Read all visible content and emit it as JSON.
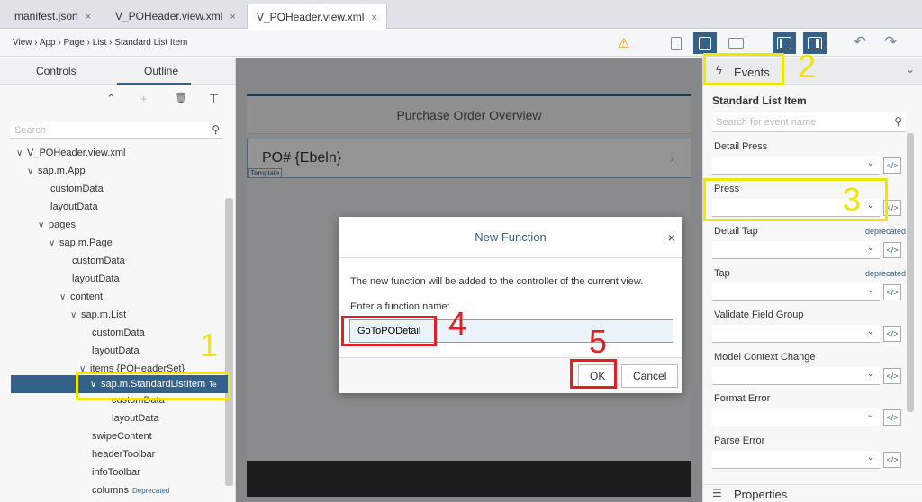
{
  "file_tabs": [
    {
      "label": "manifest.json"
    },
    {
      "label": "V_POHeader.view.xml"
    },
    {
      "label": "V_POHeader.view.xml"
    }
  ],
  "tab_close": "×",
  "toolbar": {
    "breadcrumb": "View › App › Page › List › Standard List Item",
    "warning_icon": "⚠",
    "undo_icon": "↶",
    "redo_icon": "↷"
  },
  "left": {
    "tabs": [
      "Controls",
      "Outline"
    ],
    "tools": {
      "up": "⌃",
      "add": "+",
      "delete": "🗑",
      "filter": "⊤"
    },
    "search_placeholder": "Search",
    "search_icon": "⚲",
    "tree": [
      {
        "arrow": "∨",
        "label": "V_POHeader.view.xml"
      },
      {
        "arrow": "∨",
        "label": "sap.m.App"
      },
      {
        "arrow": "",
        "label": "customData"
      },
      {
        "arrow": "",
        "label": "layoutData"
      },
      {
        "arrow": "∨",
        "label": "pages"
      },
      {
        "arrow": "∨",
        "label": "sap.m.Page"
      },
      {
        "arrow": "",
        "label": "customData"
      },
      {
        "arrow": "",
        "label": "layoutData"
      },
      {
        "arrow": "∨",
        "label": "content"
      },
      {
        "arrow": "∨",
        "label": "sap.m.List"
      },
      {
        "arrow": "",
        "label": "customData"
      },
      {
        "arrow": "",
        "label": "layoutData"
      },
      {
        "arrow": "∨",
        "label": "items {POHeaderSet}"
      },
      {
        "arrow": "∨",
        "label": "sap.m.StandardListItem",
        "suffix": "Te"
      },
      {
        "arrow": "",
        "label": "customData"
      },
      {
        "arrow": "",
        "label": "layoutData"
      },
      {
        "arrow": "",
        "label": "swipeContent"
      },
      {
        "arrow": "",
        "label": "headerToolbar"
      },
      {
        "arrow": "",
        "label": "infoToolbar"
      },
      {
        "arrow": "",
        "label": "columns",
        "deprecated": "Deprecated"
      }
    ]
  },
  "canvas": {
    "page_title": "Purchase Order Overview",
    "list_item_title": "PO# {Ebeln}",
    "list_item_chevron": "›",
    "template_label": "Template"
  },
  "dialog": {
    "title": "New Function",
    "close": "×",
    "message": "The new function will be added to the controller of the current view.",
    "input_label": "Enter a function name:",
    "input_value": "GoToPODetail",
    "ok_label": "OK",
    "cancel_label": "Cancel"
  },
  "right": {
    "header_label": "Events",
    "bolt_icon": "ϟ",
    "header_chevron": "⌄",
    "title": "Standard List Item",
    "search_placeholder": "Search for event name",
    "search_icon": "⚲",
    "dropdown_icon": "⌄",
    "code_icon": "</>",
    "events": [
      {
        "name": "Detail Press",
        "deprecated": ""
      },
      {
        "name": "Press",
        "deprecated": ""
      },
      {
        "name": "Detail Tap",
        "deprecated": "deprecated"
      },
      {
        "name": "Tap",
        "deprecated": "deprecated"
      },
      {
        "name": "Validate Field Group",
        "deprecated": ""
      },
      {
        "name": "Model Context Change",
        "deprecated": ""
      },
      {
        "name": "Format Error",
        "deprecated": ""
      },
      {
        "name": "Parse Error",
        "deprecated": ""
      }
    ],
    "properties_icon": "☰",
    "properties_label": "Properties"
  },
  "annotations": {
    "numbers": [
      "1",
      "2",
      "3",
      "4",
      "5"
    ],
    "yellow": "#f2e600",
    "red": "#e31e24"
  },
  "colors": {
    "accent": "#346187",
    "tab_bar": "#dfe3e8"
  }
}
